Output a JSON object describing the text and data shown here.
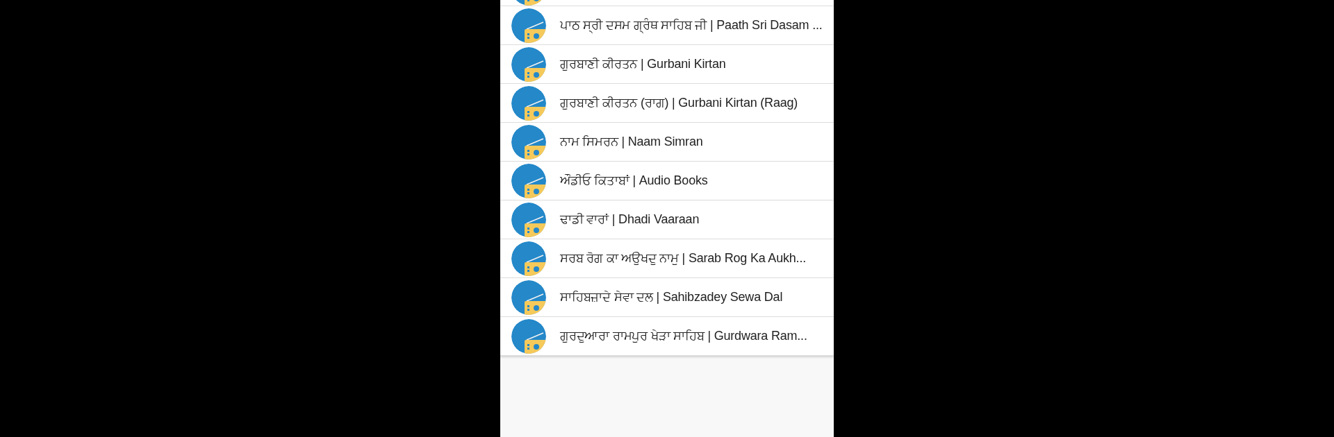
{
  "stations": [
    {
      "kind": "cut"
    },
    {
      "kind": "station",
      "title": "ਪਾਠ ਸ੍ਰੀ ਦਸਮ ਗ੍ਰੰਥ ਸਾਹਿਬ ਜੀ | Paath Sri Dasam ..."
    },
    {
      "kind": "station",
      "title": "ਗੁਰਬਾਣੀ ਕੀਰਤਨ | Gurbani Kirtan"
    },
    {
      "kind": "station",
      "title": "ਗੁਰਬਾਣੀ ਕੀਰਤਨ (ਰਾਗ) | Gurbani Kirtan (Raag)"
    },
    {
      "kind": "station",
      "title": "ਨਾਮ ਸਿਮਰਨ | Naam Simran"
    },
    {
      "kind": "station",
      "title": "ਔਡੀਓ ਕਿਤਾਬਾਂ | Audio Books"
    },
    {
      "kind": "station",
      "title": "ਢਾਡੀ ਵਾਰਾਂ | Dhadi Vaaraan"
    },
    {
      "kind": "station",
      "title": "ਸਰਬ ਰੋਗ ਕਾ ਅਉਖਦੁ ਨਾਮੁ | Sarab Rog Ka Aukh..."
    },
    {
      "kind": "station",
      "title": "ਸਾਹਿਬਜ਼ਾਦੇ ਸੇਵਾ ਦਲ | Sahibzadey Sewa Dal"
    },
    {
      "kind": "station",
      "title": "ਗੁਰਦੁਆਰਾ ਰਾਮਪੁਰ ਖੇੜਾ ਸਾਹਿਬ | Gurdwara Ram..."
    }
  ]
}
